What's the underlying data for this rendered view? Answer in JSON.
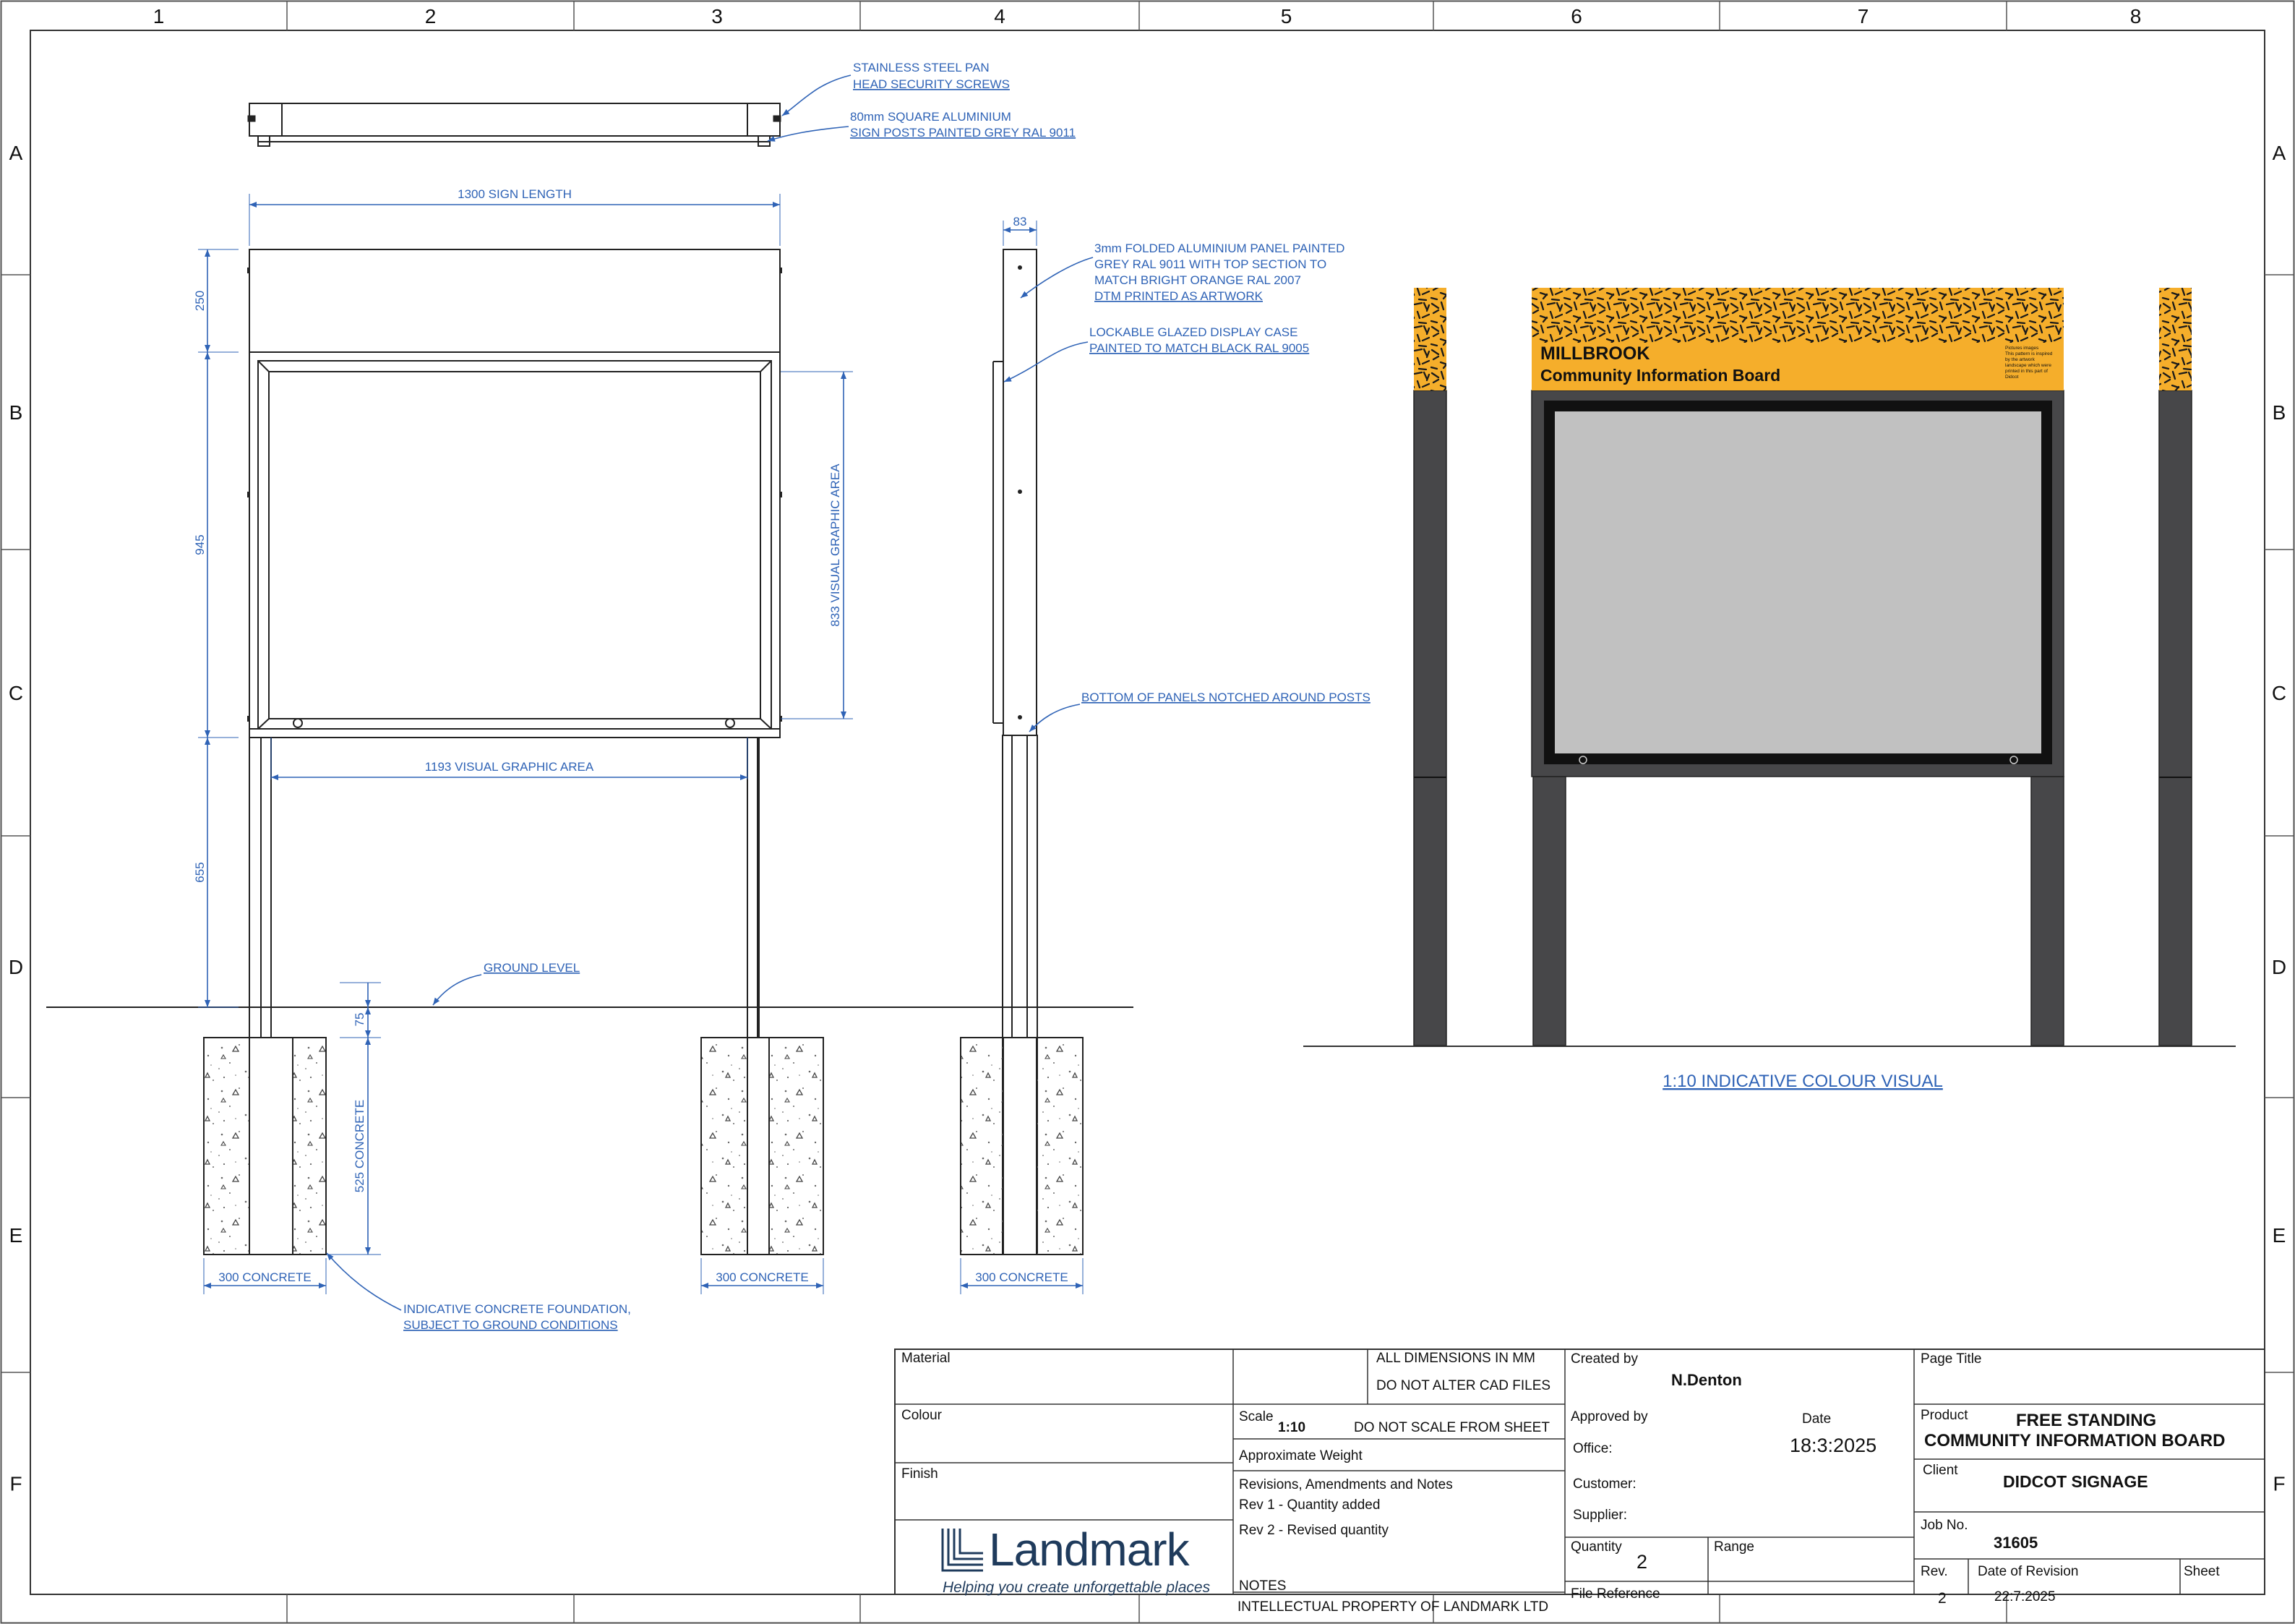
{
  "grid": {
    "columns": [
      "1",
      "2",
      "3",
      "4",
      "5",
      "6",
      "7",
      "8"
    ],
    "rows": [
      "A",
      "B",
      "C",
      "D",
      "E",
      "F"
    ]
  },
  "callouts": {
    "screws": [
      "STAINLESS STEEL PAN",
      "HEAD SECURITY SCREWS"
    ],
    "posts": [
      "80mm SQUARE ALUMINIUM",
      "SIGN POSTS PAINTED GREY RAL 9011"
    ],
    "panel": [
      "3mm FOLDED ALUMINIUM PANEL PAINTED",
      "GREY RAL 9011 WITH TOP SECTION TO",
      "MATCH BRIGHT ORANGE RAL 2007",
      "DTM PRINTED AS ARTWORK"
    ],
    "case": [
      "LOCKABLE GLAZED DISPLAY CASE",
      "PAINTED TO MATCH BLACK RAL 9005"
    ],
    "notch": "BOTTOM OF PANELS NOTCHED AROUND POSTS",
    "ground": "GROUND LEVEL",
    "foundation": [
      "INDICATIVE CONCRETE FOUNDATION,",
      "SUBJECT TO GROUND CONDITIONS"
    ]
  },
  "dimensions": {
    "sign_length": "1300 SIGN LENGTH",
    "side_depth": "83",
    "top_section": "250",
    "case_height": "945",
    "post_height": "655",
    "visual_height": "833 VISUAL GRAPHIC AREA",
    "visual_width": "1193 VISUAL GRAPHIC AREA",
    "ground_gap": "75",
    "concrete_depth": "525 CONCRETE",
    "concrete_width": "300 CONCRETE"
  },
  "visual": {
    "caption": "1:10 INDICATIVE COLOUR VISUAL",
    "board_title": "MILLBROOK",
    "board_subtitle": "Community Information Board",
    "small_print": [
      "Pictures images",
      "This pattern is inspired",
      "by the artwork",
      "landscape which were",
      "printed in this part of",
      "Didcot"
    ],
    "colors": {
      "orange": "#f5ae2b",
      "post_grey": "#474749",
      "frame_black": "#111111",
      "panel_grey": "#c1c1c1",
      "line_blue": "#2f63b6"
    }
  },
  "title_block": {
    "material_label": "Material",
    "colour_label": "Colour",
    "finish_label": "Finish",
    "dims_note": "ALL DIMENSIONS IN MM",
    "cad_note": "DO NOT ALTER CAD FILES",
    "scale_label": "Scale",
    "scale_value": "1:10",
    "scale_note": "DO NOT SCALE FROM SHEET",
    "weight_label": "Approximate Weight",
    "revisions_label": "Revisions, Amendments and Notes",
    "rev1": "Rev 1 - Quantity added",
    "rev2": "Rev 2 - Revised quantity",
    "notes_label": "NOTES",
    "ip_note": "INTELLECTUAL PROPERTY OF LANDMARK LTD",
    "created_label": "Created by",
    "created_value": "N.Denton",
    "approved_label": "Approved by",
    "date_label": "Date",
    "date_value": "18:3:2025",
    "office_label": "Office:",
    "customer_label": "Customer:",
    "supplier_label": "Supplier:",
    "quantity_label": "Quantity",
    "quantity_value": "2",
    "range_label": "Range",
    "file_ref_label": "File Reference",
    "page_title_label": "Page Title",
    "product_label": "Product",
    "product_value_1": "FREE STANDING",
    "product_value_2": "COMMUNITY INFORMATION BOARD",
    "client_label": "Client",
    "client_value": "DIDCOT SIGNAGE",
    "job_label": "Job No.",
    "job_value": "31605",
    "rev_label": "Rev.",
    "rev_value": "2",
    "date_rev_label": "Date of Revision",
    "date_rev_value": "22:7:2025",
    "sheet_label": "Sheet",
    "logo_name": "Landmark",
    "logo_tagline": "Helping you create unforgettable places"
  }
}
